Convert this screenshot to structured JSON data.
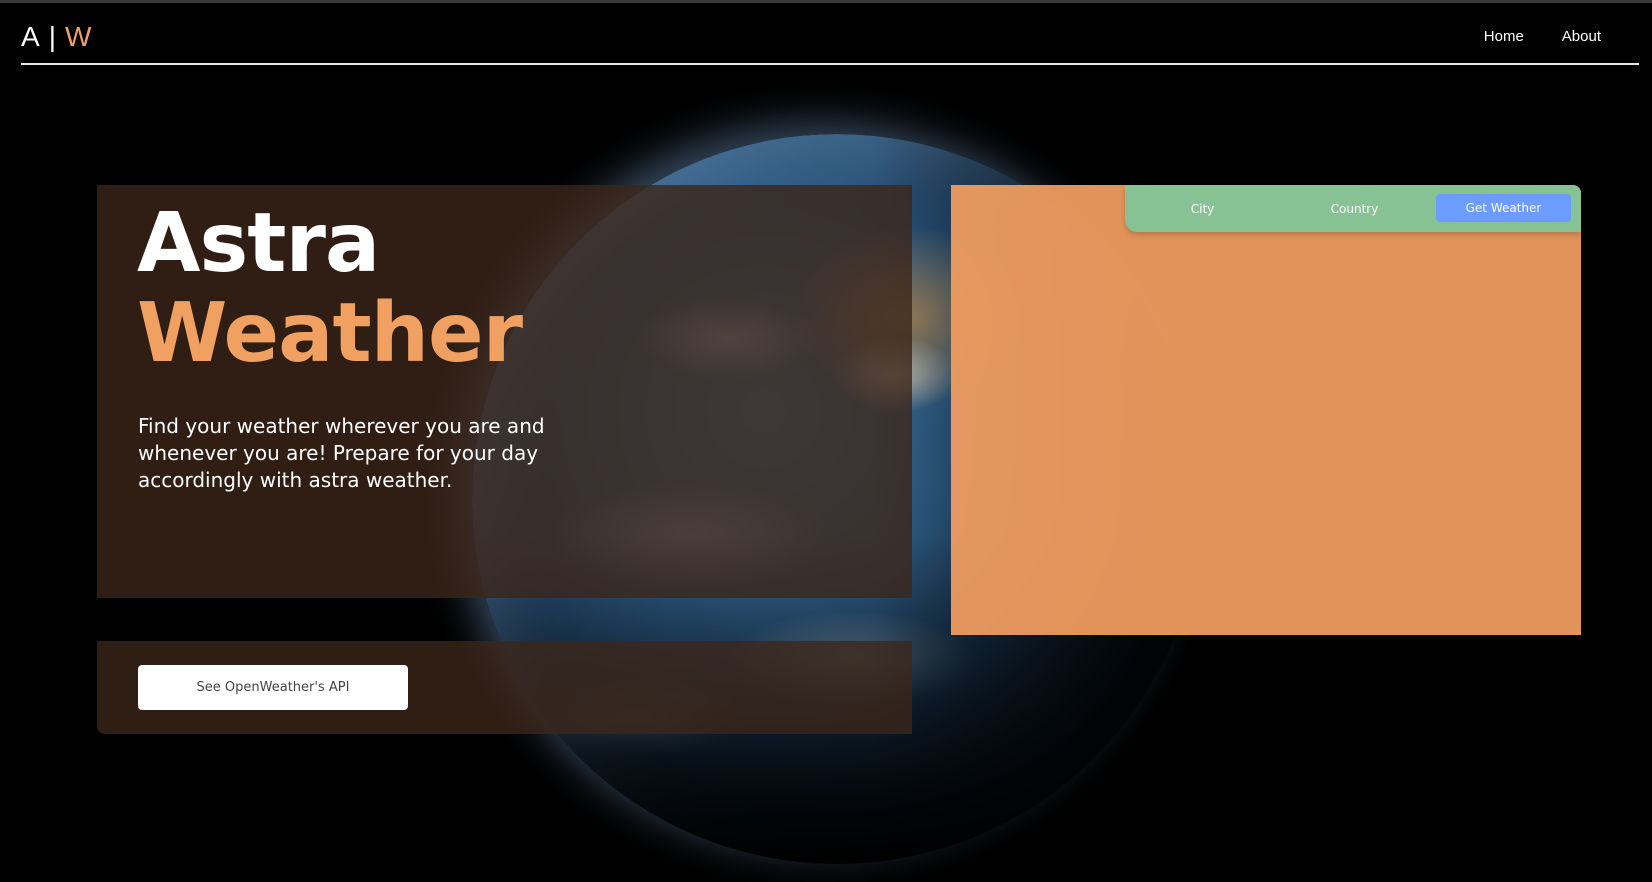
{
  "nav": {
    "logo_a": "A",
    "logo_sep": "|",
    "logo_w": "W",
    "links": [
      "Home",
      "About"
    ]
  },
  "hero": {
    "title_line1": "Astra",
    "title_line2": "Weather",
    "tagline": "Find your weather wherever you are and whenever you are! Prepare for your day accordingly with astra weather."
  },
  "cta": {
    "api_button_label": "See OpenWeather's API"
  },
  "search": {
    "city_placeholder": "City",
    "country_placeholder": "Country",
    "submit_label": "Get Weather"
  },
  "colors": {
    "accent_orange": "#f0a060",
    "panel_brown": "#3c2619",
    "search_green": "#86c293",
    "button_blue": "#6c9cff",
    "weather_panel": "#f09c60"
  }
}
